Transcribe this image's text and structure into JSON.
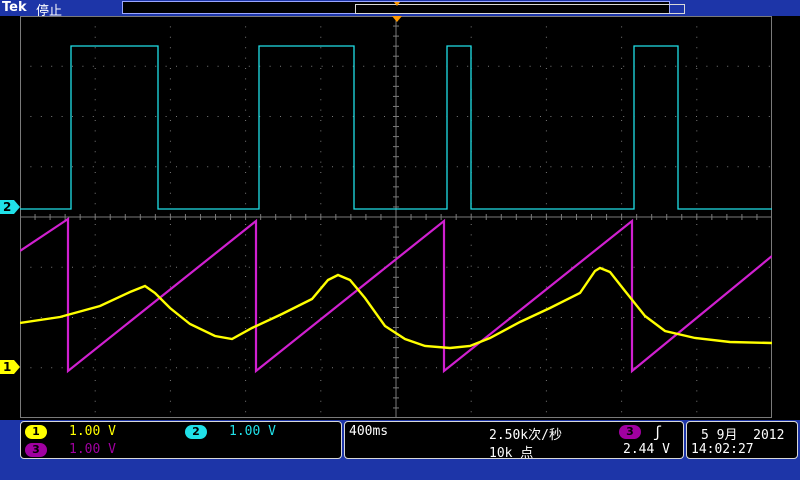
{
  "header": {
    "brand": "Tek",
    "status": "停止"
  },
  "channels": {
    "ch1": {
      "badge": "1",
      "scale": "1.00 V",
      "color": "#ffff00"
    },
    "ch2": {
      "badge": "2",
      "scale": "1.00 V",
      "color": "#20e0e8"
    },
    "ch3": {
      "badge": "3",
      "scale": "1.00 V",
      "color": "#d020d0"
    }
  },
  "timebase": {
    "scale": "400ms",
    "sample_rate": "2.50k次/秒",
    "record_length": "10k 点"
  },
  "trigger": {
    "source_badge": "3",
    "slope_symbol": "ʃ",
    "level": "2.44 V"
  },
  "datetime": {
    "date": "5 9月  2012",
    "time": "14:02:27"
  },
  "screen_marks": {
    "ch2_marker": "2",
    "ch1_marker": "1"
  },
  "colors": {
    "bezel": "#1d35a8",
    "grid": "#7a7a7a",
    "trigger_marker": "#ff9a00"
  }
}
